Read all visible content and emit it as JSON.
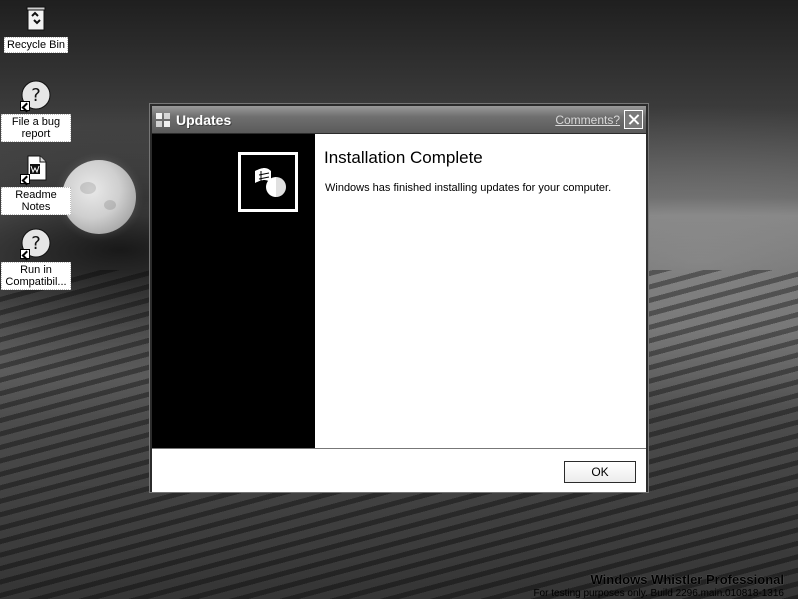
{
  "desktop": {
    "icons": [
      {
        "label": "Recycle Bin",
        "icon": "recycle-bin-icon"
      },
      {
        "label": "File a bug report",
        "icon": "help-question-icon"
      },
      {
        "label": "Readme Notes",
        "icon": "document-icon"
      },
      {
        "label": "Run in Compatibil...",
        "icon": "help-question-icon"
      }
    ],
    "watermark": {
      "line1": "Windows Whistler Professional",
      "line2": "For testing purposes only. Build 2296.main.010818-1316"
    }
  },
  "window": {
    "title": "Updates",
    "comments_link": "Comments?",
    "heading": "Installation Complete",
    "message": "Windows has finished installing updates for your computer.",
    "ok_label": "OK"
  }
}
